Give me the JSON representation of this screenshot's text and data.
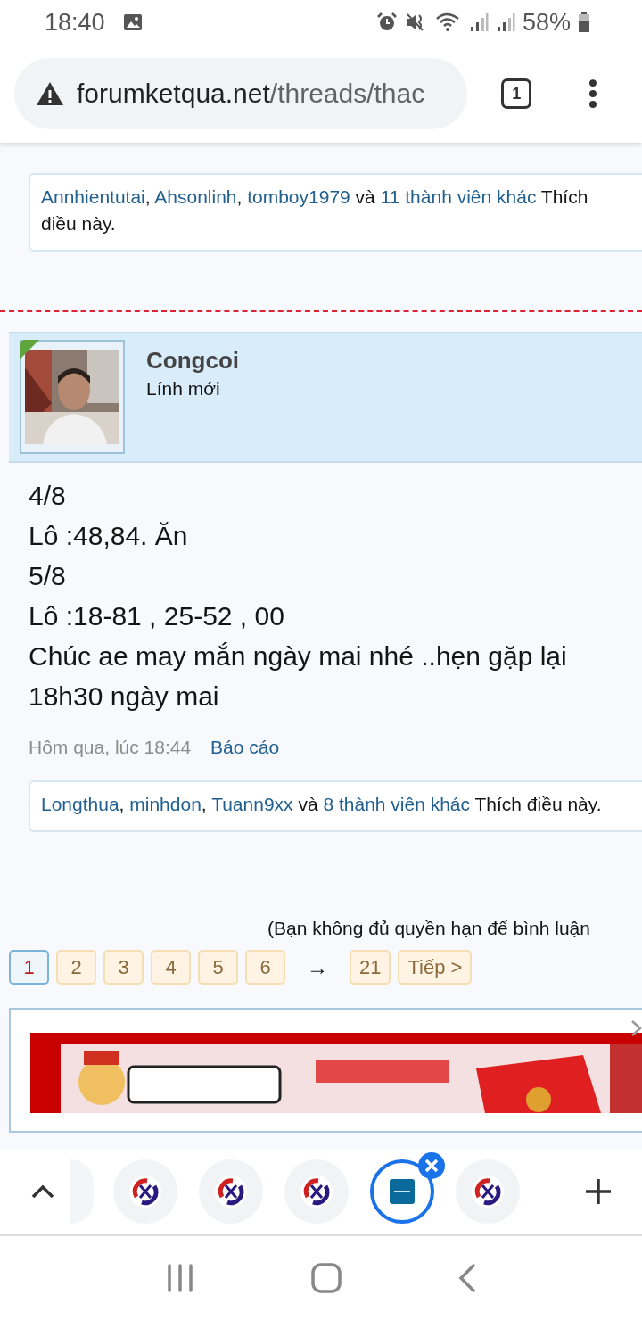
{
  "status_bar": {
    "time": "18:40",
    "battery": "58%"
  },
  "address_bar": {
    "host": "forumketqua.net",
    "path": "/threads/thac",
    "tab_count": "1"
  },
  "previous_post": {
    "likes": {
      "names": [
        "Annhientutai",
        "Ahsonlinh",
        "tomboy1979"
      ],
      "separator": ",",
      "conjunction": "và",
      "others": "11 thành viên khác",
      "suffix": "Thích điều này."
    }
  },
  "post": {
    "author": "Congcoi",
    "role": "Lính mới",
    "avatar": {
      "kind": "picture"
    },
    "lines": [
      "4/8",
      "Lô :48,84. Ăn",
      "5/8",
      "Lô :18-81 , 25-52 , 00",
      "Chúc ae may mắn ngày mai nhé ..hẹn gặp lại 18h30 ngày mai"
    ],
    "time": "Hôm qua, lúc 18:44",
    "report": "Báo cáo",
    "likes": {
      "names": [
        "Longthua",
        "minhdon",
        "Tuann9xx"
      ],
      "separator": ",",
      "conjunction": "và",
      "others": "8 thành viên khác",
      "suffix": "Thích điều này."
    }
  },
  "permission_note": "(Bạn không đủ quyền hạn để bình luận",
  "pagination": {
    "pages": [
      {
        "label": "1",
        "selected": true
      },
      {
        "label": "2",
        "selected": false
      },
      {
        "label": "3",
        "selected": false
      },
      {
        "label": "4",
        "selected": false
      },
      {
        "label": "5",
        "selected": false
      },
      {
        "label": "6",
        "selected": false
      }
    ],
    "arrow": "→",
    "last": "21",
    "next": "Tiếp >"
  },
  "ad": {
    "kind": "picture"
  },
  "tab_strip": {
    "tabs": [
      {
        "kind": "partial",
        "selected": false
      },
      {
        "kind": "x-logo",
        "selected": false
      },
      {
        "kind": "x-logo",
        "selected": false
      },
      {
        "kind": "x-logo",
        "selected": false
      },
      {
        "kind": "blue-square",
        "selected": true
      },
      {
        "kind": "x-logo",
        "selected": false
      }
    ]
  }
}
